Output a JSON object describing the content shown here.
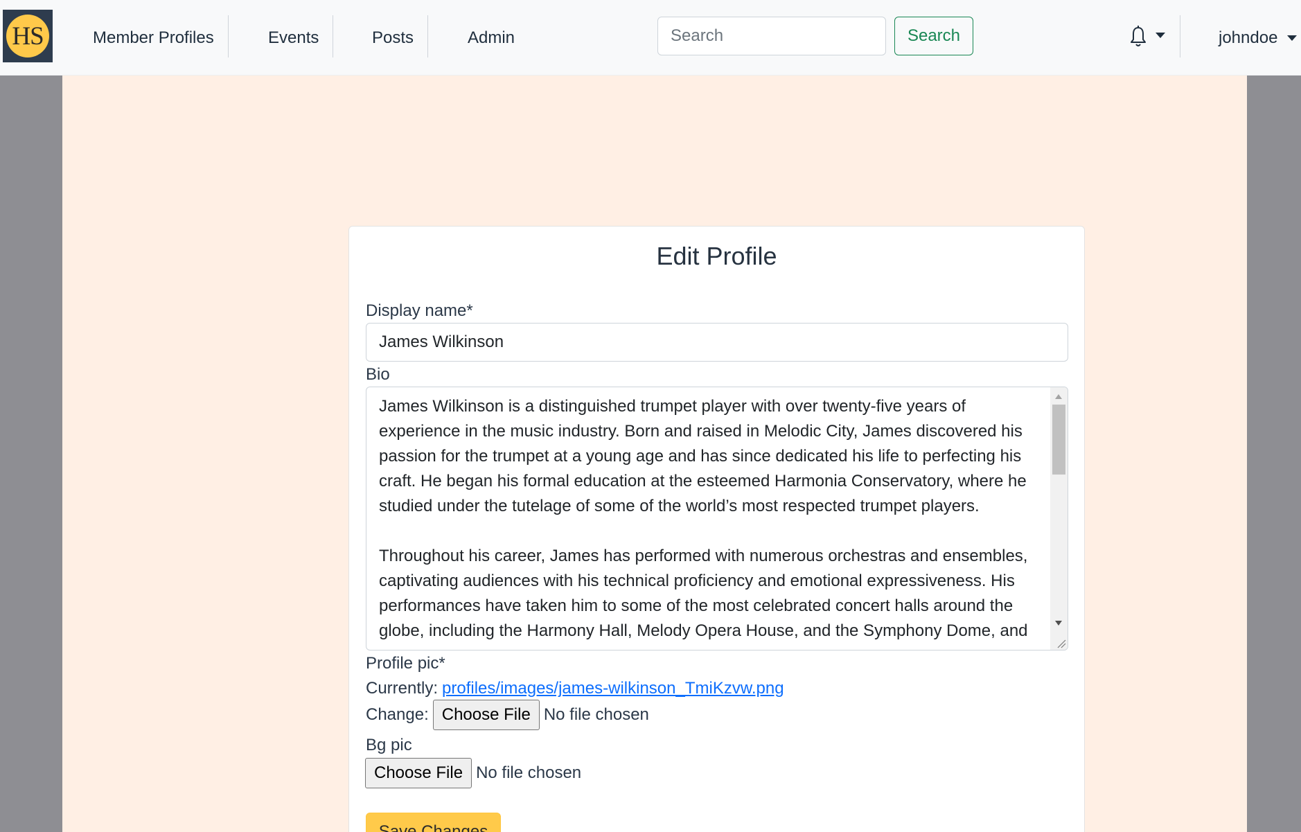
{
  "brand": {
    "logo_text": "HS"
  },
  "nav": {
    "links": [
      "Member Profiles",
      "Events",
      "Posts",
      "Admin"
    ],
    "search_placeholder": "Search",
    "search_button": "Search",
    "notifications_icon": "bell-icon",
    "username": "johndoe"
  },
  "form": {
    "title": "Edit Profile",
    "display_name_label": "Display name*",
    "display_name_value": "James Wilkinson",
    "bio_label": "Bio",
    "bio_value": "James Wilkinson is a distinguished trumpet player with over twenty-five years of experience in the music industry. Born and raised in Melodic City, James discovered his passion for the trumpet at a young age and has since dedicated his life to perfecting his craft. He began his formal education at the esteemed Harmonia Conservatory, where he studied under the tutelage of some of the world’s most respected trumpet players.\n\nThroughout his career, James has performed with numerous orchestras and ensembles, captivating audiences with his technical proficiency and emotional expressiveness. His performances have taken him to some of the most celebrated concert halls around the globe, including the Harmony Hall, Melody Opera House, and the Symphony Dome, and",
    "profile_pic_label": "Profile pic*",
    "currently_label": "Currently:",
    "current_file": "profiles/images/james-wilkinson_TmiKzvw.png",
    "change_label": "Change:",
    "choose_file": "Choose File",
    "no_file": "No file chosen",
    "bg_pic_label": "Bg pic",
    "save_button": "Save Changes"
  },
  "colors": {
    "navbar_bg": "#f8f9fa",
    "page_bg": "#ffefe4",
    "side_bg": "#8e8e93",
    "logo_bg": "#2e3c4e",
    "logo_circle": "#ffc94a",
    "success": "#198754",
    "warning": "#ffca4a",
    "link": "#0d6efd"
  }
}
